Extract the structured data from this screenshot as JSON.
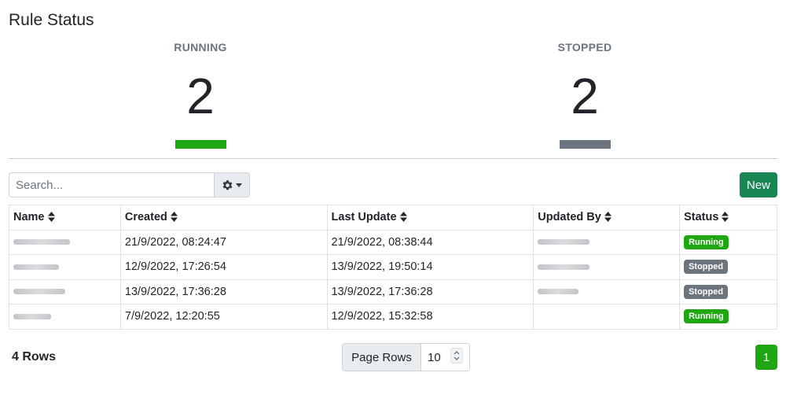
{
  "page": {
    "title": "Rule Status"
  },
  "stats": {
    "running": {
      "label": "RUNNING",
      "value": "2",
      "color": "#1fa713"
    },
    "stopped": {
      "label": "STOPPED",
      "value": "2",
      "color": "#6c757d"
    }
  },
  "toolbar": {
    "search_placeholder": "Search...",
    "settings_icon": "gear-icon",
    "new_label": "New",
    "new_color": "#198754"
  },
  "table": {
    "headers": {
      "name": "Name",
      "created": "Created",
      "last_update": "Last Update",
      "updated_by": "Updated By",
      "status": "Status"
    },
    "rows": [
      {
        "created": "21/9/2022, 08:24:47",
        "last_update": "21/9/2022, 08:38:44",
        "status": "Running"
      },
      {
        "created": "12/9/2022, 17:26:54",
        "last_update": "13/9/2022, 19:50:14",
        "status": "Stopped"
      },
      {
        "created": "13/9/2022, 17:36:28",
        "last_update": "13/9/2022, 17:36:28",
        "status": "Stopped"
      },
      {
        "created": "7/9/2022, 12:20:55",
        "last_update": "12/9/2022, 15:32:58",
        "status": "Running"
      }
    ],
    "status_colors": {
      "Running": "#1fa713",
      "Stopped": "#6c757d"
    }
  },
  "footer": {
    "rows_label": "4 Rows",
    "page_rows_label": "Page Rows",
    "page_rows_value": "10",
    "current_page": "1"
  }
}
